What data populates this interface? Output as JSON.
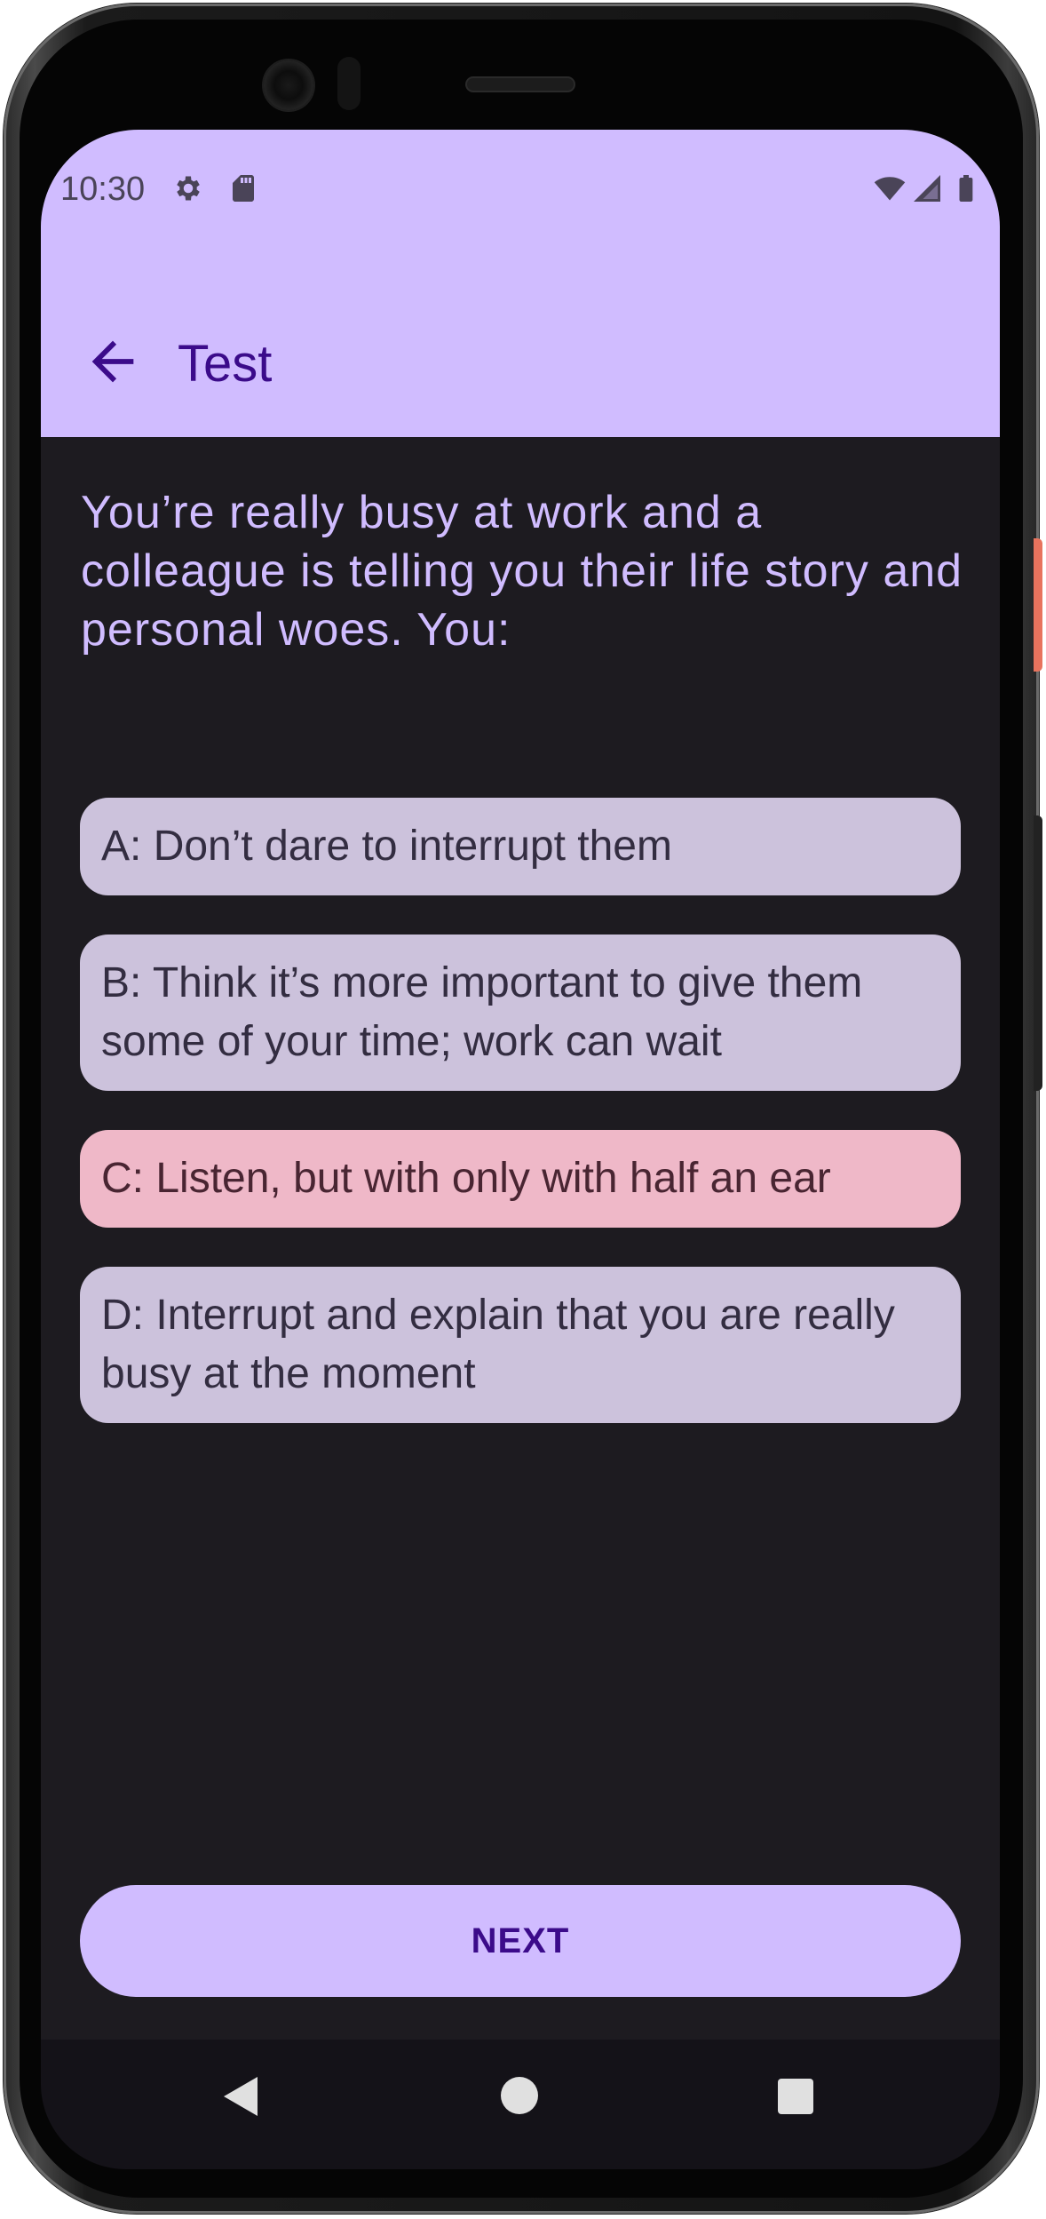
{
  "status_bar": {
    "time": "10:30",
    "icons": [
      "settings-icon",
      "sd-card-icon",
      "wifi-icon",
      "signal-icon",
      "battery-icon"
    ]
  },
  "app_bar": {
    "title": "Test",
    "back_icon": "arrow-back-icon"
  },
  "question": {
    "text": "You’re really busy at work and a colleague is telling you their life story and personal woes. You:"
  },
  "options": [
    {
      "label": "A: Don’t dare to interrupt them",
      "selected": false
    },
    {
      "label": "B: Think it’s more important to give them some of your time; work can wait",
      "selected": false
    },
    {
      "label": "C: Listen, but with only with half an ear",
      "selected": true
    },
    {
      "label": "D: Interrupt and explain that you are really busy at the moment",
      "selected": false
    }
  ],
  "next_button": {
    "label": "NEXT"
  },
  "nav_bar": {
    "buttons": [
      "nav-back-icon",
      "nav-home-icon",
      "nav-recents-icon"
    ]
  },
  "colors": {
    "primary": "#d0bcff",
    "on_primary_container": "#3b0b8a",
    "background": "#1d1b20",
    "option_bg": "#ccc2dc",
    "selected_option_bg": "#efb8c8"
  }
}
